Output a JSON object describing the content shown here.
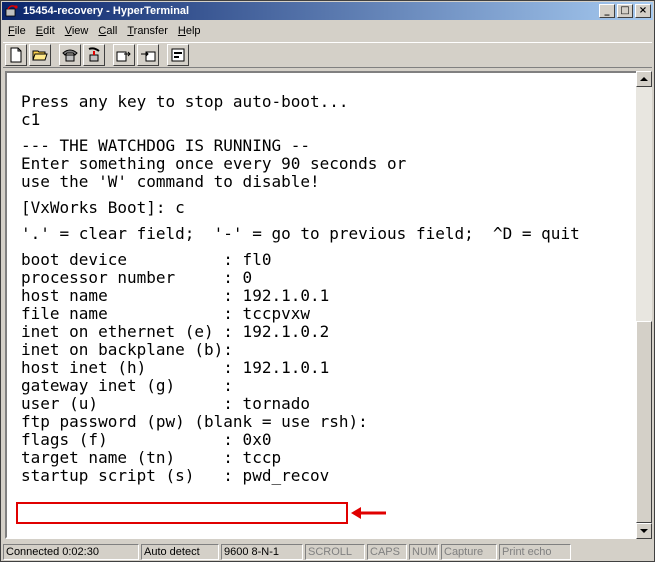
{
  "window": {
    "title": "15454-recovery - HyperTerminal",
    "minimize_label": "_",
    "maximize_label": "□",
    "close_label": "×"
  },
  "menu": {
    "file": {
      "u": "F",
      "rest": "ile"
    },
    "edit": {
      "u": "E",
      "rest": "dit"
    },
    "view": {
      "u": "V",
      "rest": "iew"
    },
    "call": {
      "u": "C",
      "rest": "all"
    },
    "transfer": {
      "u": "T",
      "rest": "ransfer"
    },
    "help": {
      "u": "H",
      "rest": "elp"
    }
  },
  "toolbar_icons": [
    "new-document-icon",
    "open-folder-icon",
    "connect-phone-icon",
    "disconnect-phone-icon",
    "send-file-icon",
    "receive-file-icon",
    "properties-icon"
  ],
  "terminal": {
    "lines": [
      "Press any key to stop auto-boot...",
      "c1",
      "",
      "--- THE WATCHDOG IS RUNNING --",
      "Enter something once every 90 seconds or",
      "use the 'W' command to disable!",
      "",
      "[VxWorks Boot]: c",
      "",
      "'.' = clear field;  '-' = go to previous field;  ^D = quit",
      "",
      "boot device          : fl0",
      "processor number     : 0",
      "host name            : 192.1.0.1",
      "file name            : tccpvxw",
      "inet on ethernet (e) : 192.1.0.2",
      "inet on backplane (b):",
      "host inet (h)        : 192.1.0.1",
      "gateway inet (g)     :",
      "user (u)             : tornado",
      "ftp password (pw) (blank = use rsh):",
      "flags (f)            : 0x0",
      "target name (tn)     : tccp",
      "startup script (s)   : pwd_recov"
    ]
  },
  "annotation": {
    "highlight_color": "#e00000"
  },
  "status": {
    "connected": "Connected 0:02:30",
    "detect": "Auto detect",
    "settings": "9600 8-N-1",
    "scroll": "SCROLL",
    "caps": "CAPS",
    "num": "NUM",
    "capture": "Capture",
    "print_echo": "Print echo"
  }
}
